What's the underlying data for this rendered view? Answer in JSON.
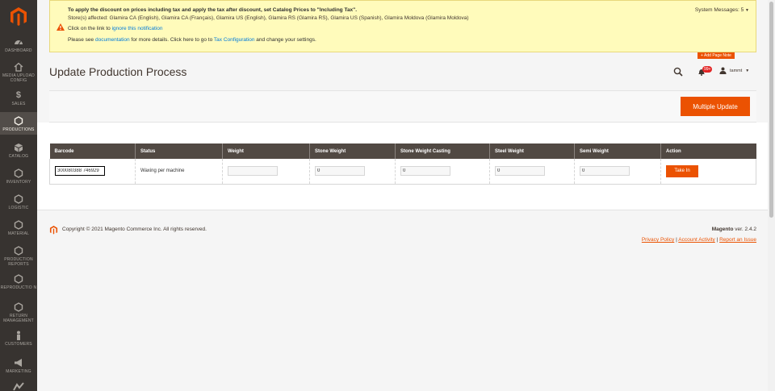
{
  "sidebar": {
    "items": [
      {
        "label": "Dashboard",
        "icon": "dashboard-icon"
      },
      {
        "label": "Media Upload Config",
        "icon": "home-icon"
      },
      {
        "label": "Sales",
        "icon": "dollar-icon"
      },
      {
        "label": "Productions",
        "icon": "hexagon-icon",
        "active": true
      },
      {
        "label": "Catalog",
        "icon": "cube-icon"
      },
      {
        "label": "Inventory",
        "icon": "hexagon-icon"
      },
      {
        "label": "Logistic",
        "icon": "hexagon-icon"
      },
      {
        "label": "Material",
        "icon": "hexagon-icon"
      },
      {
        "label": "Production Reports",
        "icon": "hexagon-icon"
      },
      {
        "label": "Reproductio n",
        "icon": "hexagon-icon"
      },
      {
        "label": "Return Management",
        "icon": "hexagon-icon"
      },
      {
        "label": "Customers",
        "icon": "person-icon"
      },
      {
        "label": "Marketing",
        "icon": "megaphone-icon"
      }
    ]
  },
  "system_message": {
    "line1": "To apply the discount on prices including tax and apply the tax after discount, set Catalog Prices to \"Including Tax\".",
    "line2": "Store(s) affected: Glamira CA (English), Glamira CA (Français), Glamira US (English), Glamira RS (Glamira RS), Glamira US (Spanish), Glamira Moldova (Glamira Moldova)",
    "line3_prefix": "Click on the link to ",
    "line3_link": "ignore this notification",
    "line4_prefix": "Please see ",
    "line4_link1": "documentation",
    "line4_middle": " for more details. Click here to go to ",
    "line4_link2": "Tax Configuration",
    "line4_suffix": " and change your settings.",
    "count_label": "System Messages: 5"
  },
  "header": {
    "add_note": "+ Add Page Note",
    "page_title": "Update Production Process",
    "notification_count": "99+",
    "user_name": "tammt"
  },
  "actions": {
    "multiple_update": "Multiple Update"
  },
  "table": {
    "columns": [
      "Barcode",
      "Status",
      "Weight",
      "Stone Weight",
      "Stone Weight Casting",
      "Steel Weight",
      "Semi Weight",
      "Action"
    ],
    "row": {
      "barcode": "300080388 746929",
      "status": "Waxing per machine",
      "weight": "",
      "stone_weight": "0",
      "stone_weight_casting": "0",
      "steel_weight": "0",
      "semi_weight": "0",
      "action": "Take In"
    }
  },
  "footer": {
    "copyright": "Copyright © 2021 Magento Commerce Inc. All rights reserved.",
    "brand": "Magento",
    "version": "ver. 2.4.2",
    "links": [
      "Privacy Policy",
      "Account Activity",
      "Report an Issue"
    ]
  },
  "colors": {
    "accent": "#eb5202",
    "sidebar": "#373330",
    "table_header": "#514943",
    "notice_bg": "#fffbbb"
  }
}
